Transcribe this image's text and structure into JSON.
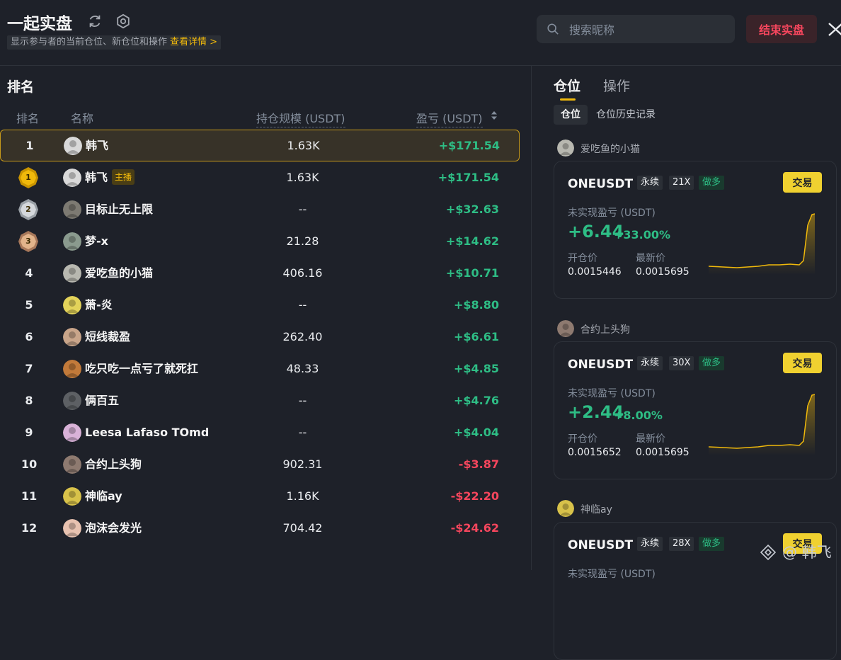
{
  "header": {
    "title": "一起实盘",
    "subtitle": "显示参与者的当前仓位、新仓位和操作",
    "details_link": "查看详情 >",
    "search_placeholder": "搜索昵称",
    "end_button": "结束实盘"
  },
  "ranking": {
    "title": "排名",
    "columns": {
      "rank": "排名",
      "name": "名称",
      "size": "持仓规模 (USDT)",
      "pnl": "盈亏 (USDT)"
    },
    "rows": [
      {
        "rank": "1",
        "medal": null,
        "name": "韩飞",
        "badge": null,
        "size": "1.63K",
        "pnl": "+$171.54",
        "sign": "pos",
        "selected": true,
        "avatar_color": "#d9d9d9"
      },
      {
        "rank": "1",
        "medal": "gold",
        "name": "韩飞",
        "badge": "主播",
        "size": "1.63K",
        "pnl": "+$171.54",
        "sign": "pos",
        "selected": false,
        "avatar_color": "#d9d9d9"
      },
      {
        "rank": "2",
        "medal": "silver",
        "name": "目标止无上限",
        "badge": null,
        "size": "--",
        "pnl": "+$32.63",
        "sign": "pos",
        "selected": false,
        "avatar_color": "#7d7a72"
      },
      {
        "rank": "3",
        "medal": "bronze",
        "name": "梦-x",
        "badge": null,
        "size": "21.28",
        "pnl": "+$14.62",
        "sign": "pos",
        "selected": false,
        "avatar_color": "#8a9a8e"
      },
      {
        "rank": "4",
        "medal": null,
        "name": "爱吃鱼的小猫",
        "badge": null,
        "size": "406.16",
        "pnl": "+$10.71",
        "sign": "pos",
        "selected": false,
        "avatar_color": "#b8b8b0"
      },
      {
        "rank": "5",
        "medal": null,
        "name": "萧-炎",
        "badge": null,
        "size": "--",
        "pnl": "+$8.80",
        "sign": "pos",
        "selected": false,
        "avatar_color": "#e3d35a"
      },
      {
        "rank": "6",
        "medal": null,
        "name": "短线裁盈",
        "badge": null,
        "size": "262.40",
        "pnl": "+$6.61",
        "sign": "pos",
        "selected": false,
        "avatar_color": "#c9a58a"
      },
      {
        "rank": "7",
        "medal": null,
        "name": "吃只吃一点亏了就死扛",
        "badge": null,
        "size": "48.33",
        "pnl": "+$4.85",
        "sign": "pos",
        "selected": false,
        "avatar_color": "#c27a3a"
      },
      {
        "rank": "8",
        "medal": null,
        "name": "俩百五",
        "badge": null,
        "size": "--",
        "pnl": "+$4.76",
        "sign": "pos",
        "selected": false,
        "avatar_color": "#5d6064"
      },
      {
        "rank": "9",
        "medal": null,
        "name": "Leesa Lafaso TOmd",
        "badge": null,
        "size": "--",
        "pnl": "+$4.04",
        "sign": "pos",
        "selected": false,
        "avatar_color": "#d9b2d8"
      },
      {
        "rank": "10",
        "medal": null,
        "name": "合约上头狗",
        "badge": null,
        "size": "902.31",
        "pnl": "-$3.87",
        "sign": "neg",
        "selected": false,
        "avatar_color": "#8e7a70"
      },
      {
        "rank": "11",
        "medal": null,
        "name": "神临ay",
        "badge": null,
        "size": "1.16K",
        "pnl": "-$22.20",
        "sign": "neg",
        "selected": false,
        "avatar_color": "#d8c24a"
      },
      {
        "rank": "12",
        "medal": null,
        "name": "泡沫会发光",
        "badge": null,
        "size": "704.42",
        "pnl": "-$24.62",
        "sign": "neg",
        "selected": false,
        "avatar_color": "#e8c2b0"
      }
    ]
  },
  "positions": {
    "tabs": {
      "positions": "仓位",
      "operations": "操作"
    },
    "subtabs": {
      "current": "仓位",
      "history": "仓位历史记录"
    },
    "cards": [
      {
        "owner": "爱吃鱼的小猫",
        "owner_avatar_color": "#b8b8b0",
        "symbol": "ONEUSDT",
        "type": "永续",
        "leverage": "21X",
        "direction": "做多",
        "trade_label": "交易",
        "upl_label": "未实现盈亏 (USDT)",
        "upl": "+6.44",
        "upl_pct": "+33.00%",
        "open_label": "开仓价",
        "last_label": "最新价",
        "open_price": "0.0015446",
        "last_price": "0.0015695"
      },
      {
        "owner": "合约上头狗",
        "owner_avatar_color": "#8e7a70",
        "symbol": "ONEUSDT",
        "type": "永续",
        "leverage": "30X",
        "direction": "做多",
        "trade_label": "交易",
        "upl_label": "未实现盈亏 (USDT)",
        "upl": "+2.44",
        "upl_pct": "+8.00%",
        "open_label": "开仓价",
        "last_label": "最新价",
        "open_price": "0.0015652",
        "last_price": "0.0015695"
      },
      {
        "owner": "神临ay",
        "owner_avatar_color": "#d8c24a",
        "symbol": "ONEUSDT",
        "type": "永续",
        "leverage": "28X",
        "direction": "做多",
        "trade_label": "交易",
        "upl_label": "未实现盈亏 (USDT)",
        "upl": "",
        "upl_pct": "",
        "open_label": "",
        "last_label": "",
        "open_price": "",
        "last_price": ""
      }
    ]
  },
  "watermark": "@ 韩飞",
  "colors": {
    "accent": "#f0b90b",
    "positive": "#2ebd85",
    "negative": "#f6465d",
    "background": "#1e2129"
  },
  "icons": [
    "refresh-icon",
    "gear-icon",
    "search-icon",
    "close-icon",
    "sort-icon",
    "diamond-icon"
  ]
}
